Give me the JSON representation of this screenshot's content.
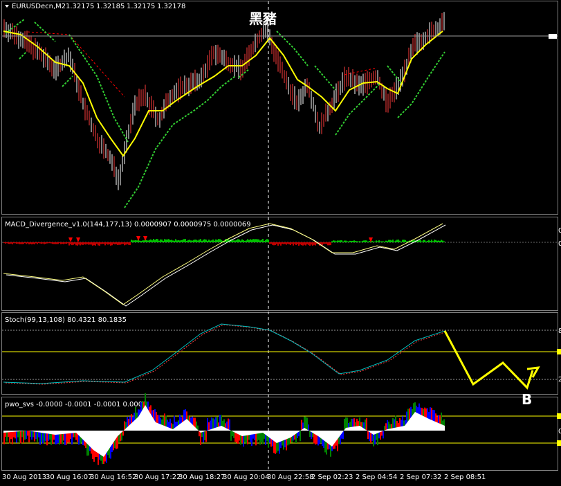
{
  "window": {
    "title": "EURUSDecn,M2",
    "title_arrow_icon": "triangle-down-icon",
    "watermark": "黑豬"
  },
  "price_pane": {
    "symbol": "EURUSDecn,M2",
    "ohlc": [
      "1.32175",
      "1.32185",
      "1.32175",
      "1.32178"
    ]
  },
  "macd_pane": {
    "title": "MACD_Divergence_v1.0(144,177,13) 0.0000907 0.0000975 0.0000069",
    "right_axis_labels": [
      "0",
      "0"
    ]
  },
  "stoch_pane": {
    "title": "Stoch(99,13,108) 80.4321 80.1835",
    "right_axis_labels": [
      "8",
      "2"
    ],
    "annotation": "B"
  },
  "pwo_pane": {
    "title": "pwo_svs -0.0000 -0.0001 -0.0001 0.0001",
    "right_axis_labels": [
      "0"
    ]
  },
  "time_axis": {
    "labels": [
      "30 Aug 2013",
      "30 Aug 16:07",
      "30 Aug 16:52",
      "30 Aug 17:22",
      "30 Aug 18:27",
      "30 Aug 20:04",
      "30 Aug 22:58",
      "2 Sep 02:23",
      "2 Sep 04:54",
      "2 Sep 07:32",
      "2 Sep 08:51"
    ]
  },
  "colors": {
    "background": "#000000",
    "grid": "#808080",
    "price_candles": "#ffffff",
    "price_down": "#ff3b3b",
    "moving_average": "#ffff00",
    "envelope": "#32cd32",
    "trend_line": "#ff0000",
    "macd_main": "#ffff80",
    "macd_signal": "#ffffff",
    "macd_hist_up": "#00c000",
    "macd_hist_down": "#c00000",
    "stoch_main": "#00bfbf",
    "stoch_signal": "#ff4040",
    "stoch_level": "#ffff00",
    "annotation_arrow": "#ffff00",
    "pwo_fill": "#ffffff",
    "pwo_red": "#ff0000",
    "pwo_blue": "#0000ff",
    "pwo_green": "#008000"
  },
  "chart_data": [
    {
      "type": "line",
      "pane": "price",
      "title": "EURUSDecn,M2",
      "x": [
        "30 Aug 2013",
        "30 Aug 16:07",
        "30 Aug 16:52",
        "30 Aug 17:22",
        "30 Aug 18:27",
        "30 Aug 20:04",
        "30 Aug 22:58",
        "2 Sep 02:23",
        "2 Sep 04:54",
        "2 Sep 07:32",
        "2 Sep 08:51"
      ],
      "series": [],
      "current_price": 1.32178
    },
    {
      "type": "line",
      "pane": "macd",
      "title": "MACD_Divergence_v1.0(144,177,13)",
      "values_printed": [
        9.07e-05,
        9.75e-05,
        6.9e-06
      ]
    },
    {
      "type": "line",
      "pane": "stochastic",
      "title": "Stoch(99,13,108)",
      "values_printed": [
        80.4321,
        80.1835
      ]
    },
    {
      "type": "area",
      "pane": "pwo",
      "title": "pwo_svs",
      "values_printed": [
        -0.0,
        -0.0001,
        -0.0001,
        0.0001
      ]
    }
  ]
}
